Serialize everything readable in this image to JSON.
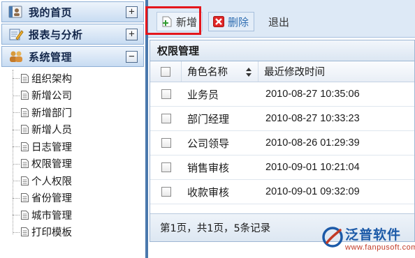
{
  "sidebar": {
    "sections": [
      {
        "title": "我的首页",
        "toggle": "+",
        "icon": "contact-card-icon"
      },
      {
        "title": "报表与分析",
        "toggle": "+",
        "icon": "edit-report-icon"
      },
      {
        "title": "系统管理",
        "toggle": "−",
        "icon": "users-group-icon"
      }
    ],
    "tree_items": [
      {
        "label": "组织架构"
      },
      {
        "label": "新增公司"
      },
      {
        "label": "新增部门"
      },
      {
        "label": "新增人员"
      },
      {
        "label": "日志管理"
      },
      {
        "label": "权限管理"
      },
      {
        "label": "个人权限"
      },
      {
        "label": "省份管理"
      },
      {
        "label": "城市管理"
      },
      {
        "label": "打印模板"
      }
    ],
    "tree_item_icon": "document-icon"
  },
  "toolbar": {
    "add_label": "新增",
    "delete_label": "删除",
    "exit_label": "退出",
    "add_icon": "add-document-icon",
    "delete_icon": "delete-x-icon",
    "highlight_color": "#e4161c"
  },
  "panel": {
    "title": "权限管理",
    "columns": {
      "role": "角色名称",
      "time": "最近修改时间"
    },
    "rows": [
      {
        "role": "业务员",
        "time": "2010-08-27 10:35:06"
      },
      {
        "role": "部门经理",
        "time": "2010-08-27 10:33:23"
      },
      {
        "role": "公司领导",
        "time": "2010-08-26 01:29:39"
      },
      {
        "role": "销售审核",
        "time": "2010-09-01 10:21:04"
      },
      {
        "role": "收款审核",
        "time": "2010-09-01 09:32:09"
      }
    ],
    "pager": "第1页，共1页，5条记录"
  },
  "watermark": {
    "name": "泛普软件",
    "url": "www.fanpusoft.com"
  },
  "colors": {
    "accent": "#4a79ad",
    "delete_text": "#2e6db1",
    "watermark_blue": "#1c5aa8",
    "watermark_red": "#c23a26"
  }
}
